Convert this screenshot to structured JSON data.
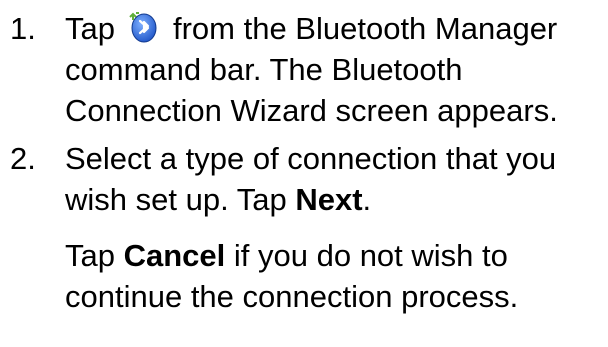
{
  "steps": [
    {
      "number": "1.",
      "lines": {
        "l1_before_icon": "Tap",
        "l1_after_icon": "from the Bluetooth Manager",
        "l2": "command bar. The Bluetooth",
        "l3": "Connection Wizard screen appears."
      },
      "icon": "bluetooth-wizard-icon"
    },
    {
      "number": "2.",
      "lines": {
        "l1": "Select a type of connection that you",
        "l2_before": "wish set up. Tap ",
        "l2_bold": "Next",
        "l2_after": "."
      }
    }
  ],
  "note": {
    "l1_before": "Tap ",
    "l1_bold": "Cancel",
    "l1_after": " if you do not wish to",
    "l2": "continue the connection process."
  },
  "colors": {
    "text": "#000000",
    "icon_blue": "#1f55c8",
    "icon_green": "#5fae3a"
  }
}
